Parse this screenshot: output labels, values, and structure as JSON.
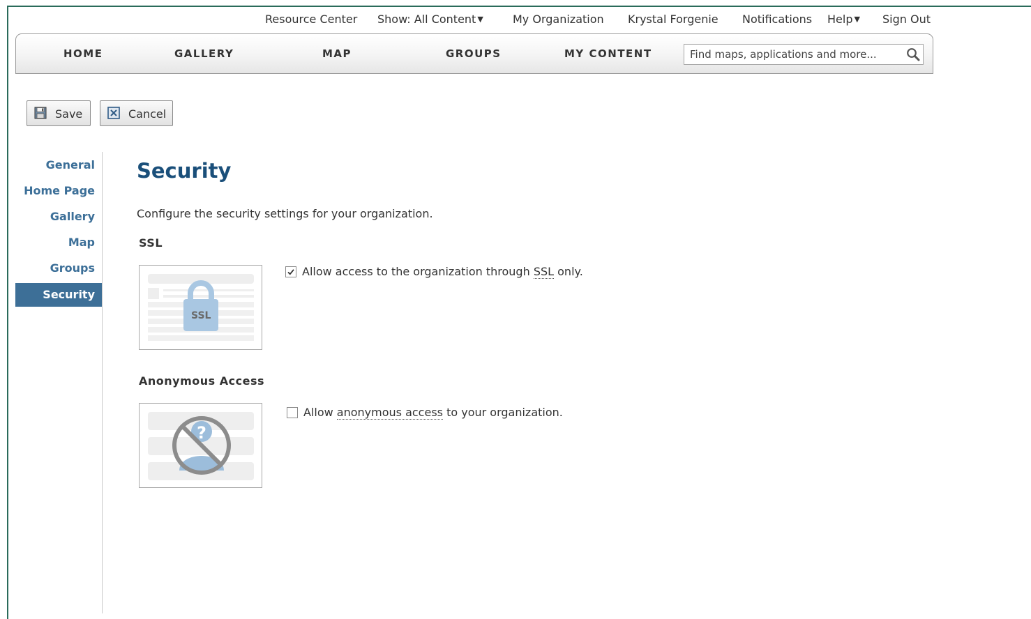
{
  "toplinks": {
    "resource_center": "Resource Center",
    "show_content": "Show: All Content",
    "my_organization": "My Organization",
    "user": "Krystal Forgenie",
    "notifications": "Notifications",
    "help": "Help",
    "sign_out": "Sign Out"
  },
  "nav": {
    "items": [
      "HOME",
      "GALLERY",
      "MAP",
      "GROUPS",
      "MY CONTENT"
    ],
    "search_placeholder": "Find maps, applications and more..."
  },
  "toolbar": {
    "save_label": "Save",
    "cancel_label": "Cancel"
  },
  "sidebar": {
    "items": [
      "General",
      "Home Page",
      "Gallery",
      "Map",
      "Groups",
      "Security"
    ],
    "active": "Security"
  },
  "main": {
    "title": "Security",
    "description": "Configure the security settings for your organization.",
    "ssl": {
      "heading": "SSL",
      "thumb_text": "SSL",
      "option_pre": "Allow access to the organization through ",
      "option_abbr": "SSL",
      "option_post": " only.",
      "checked": true
    },
    "anonymous": {
      "heading": "Anonymous Access",
      "option_pre": "Allow ",
      "option_abbr": "anonymous access",
      "option_post": " to your organization.",
      "checked": false
    }
  },
  "colors": {
    "accent": "#3d6f97",
    "link": "#3c6f98",
    "title": "#1a4f7a",
    "frame": "#2a6b5a"
  },
  "icons": {
    "search": "search-icon",
    "save": "floppy-disk-icon",
    "cancel": "cancel-x-icon",
    "caret": "caret-down-icon",
    "check": "checkmark-icon"
  }
}
